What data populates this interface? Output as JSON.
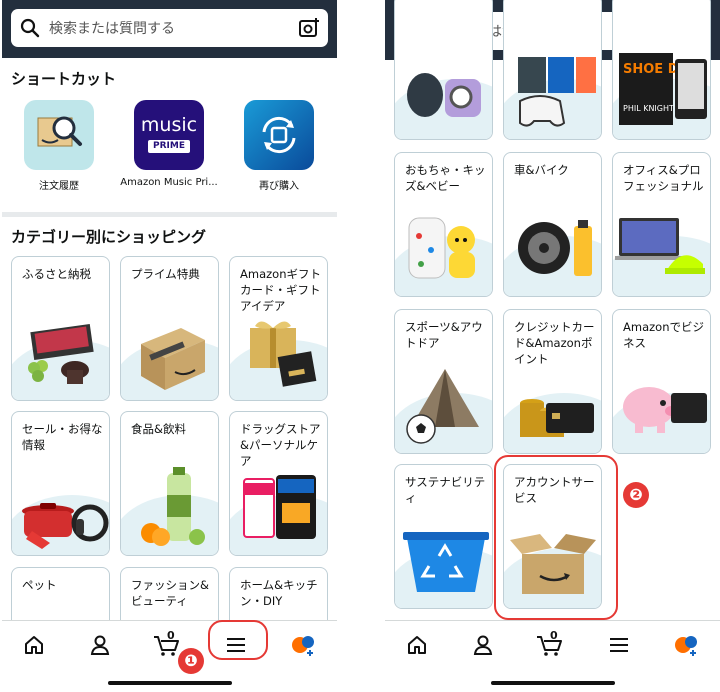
{
  "search": {
    "placeholder": "検索または質問する"
  },
  "shortcuts": {
    "title": "ショートカット",
    "items": [
      {
        "label": "注文履歴",
        "icon": "order-history-icon"
      },
      {
        "label": "Amazon Music Pri...",
        "icon": "amazon-music-prime-icon",
        "line1": "music",
        "line2": "PRIME"
      },
      {
        "label": "再び購入",
        "icon": "buy-again-icon"
      }
    ]
  },
  "categories_title": "カテゴリー別にショッピング",
  "left_cards": [
    {
      "label": "ふるさと納税"
    },
    {
      "label": "プライム特典"
    },
    {
      "label": "Amazonギフトカード・ギフトアイデア"
    },
    {
      "label": "セール・お得な情報"
    },
    {
      "label": "食品&飲料"
    },
    {
      "label": "ドラッグストア&パーソナルケア"
    },
    {
      "label": "ペット"
    },
    {
      "label": "ファッション&ビューティ"
    },
    {
      "label": "ホーム&キッチン・DIY"
    }
  ],
  "right_cards": [
    {
      "label": ""
    },
    {
      "label": ""
    },
    {
      "label": "",
      "book_title": "SHOE DOG",
      "book_author": "PHIL KNIGHT"
    },
    {
      "label": "おもちゃ・キッズ&ベビー"
    },
    {
      "label": "車&バイク"
    },
    {
      "label": "オフィス&プロフェッショナル"
    },
    {
      "label": "スポーツ&アウトドア"
    },
    {
      "label": "クレジットカード&Amazonポイント"
    },
    {
      "label": "Amazonでビジネス"
    },
    {
      "label": "サステナビリティ"
    },
    {
      "label": "アカウントサービス"
    }
  ],
  "tabbar": {
    "cart_count": "0"
  },
  "annotations": {
    "step1": "❶",
    "step2": "❷"
  },
  "colors": {
    "header": "#232f3e",
    "accent_red": "#e53935",
    "wave": "#e3f1f5"
  }
}
